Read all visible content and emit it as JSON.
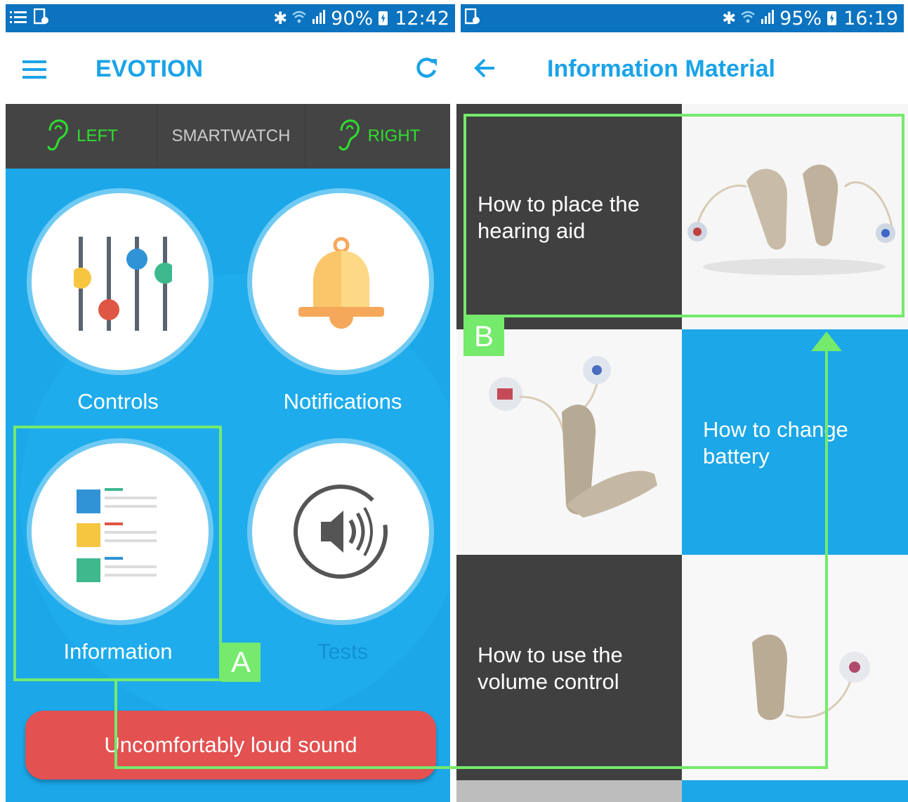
{
  "left_screen": {
    "status": {
      "battery": "90%",
      "time": "12:42"
    },
    "appbar": {
      "title": "EVOTION",
      "menu_icon": "hamburger-menu-icon",
      "refresh_icon": "refresh-icon"
    },
    "tabs": [
      {
        "label": "LEFT",
        "icon": "ear-icon"
      },
      {
        "label": "SMARTWATCH"
      },
      {
        "label": "RIGHT",
        "icon": "ear-icon"
      }
    ],
    "tiles": [
      {
        "label": "Controls",
        "icon": "equalizer-sliders-icon"
      },
      {
        "label": "Notifications",
        "icon": "bell-icon"
      },
      {
        "label": "Information",
        "icon": "document-list-icon"
      },
      {
        "label": "Tests",
        "icon": "speaker-sound-icon"
      }
    ],
    "alarm_button": "Uncomfortably loud sound"
  },
  "right_screen": {
    "status": {
      "battery": "95%",
      "time": "16:19"
    },
    "appbar": {
      "title": "Information Material",
      "back_icon": "back-arrow-icon"
    },
    "items": [
      {
        "title": "How to place the hearing aid",
        "line1": "How to place the",
        "line2": "hearing aid"
      },
      {
        "title": "How to change battery",
        "line1": "How to change",
        "line2": "battery"
      },
      {
        "title": "How to use the volume control",
        "line1": "How to use the",
        "line2": "volume control"
      }
    ]
  },
  "annotations": {
    "label_a": "A",
    "label_b": "B"
  },
  "colors": {
    "status_bar": "#0b73bf",
    "accent": "#1aa3e8",
    "tab_active": "#2ee02e",
    "tab_inactive": "#cccccc",
    "tile_background": "#1ba7e8",
    "alarm": "#e35151",
    "dark_tile": "#404040",
    "annotation": "#75ea6c"
  }
}
